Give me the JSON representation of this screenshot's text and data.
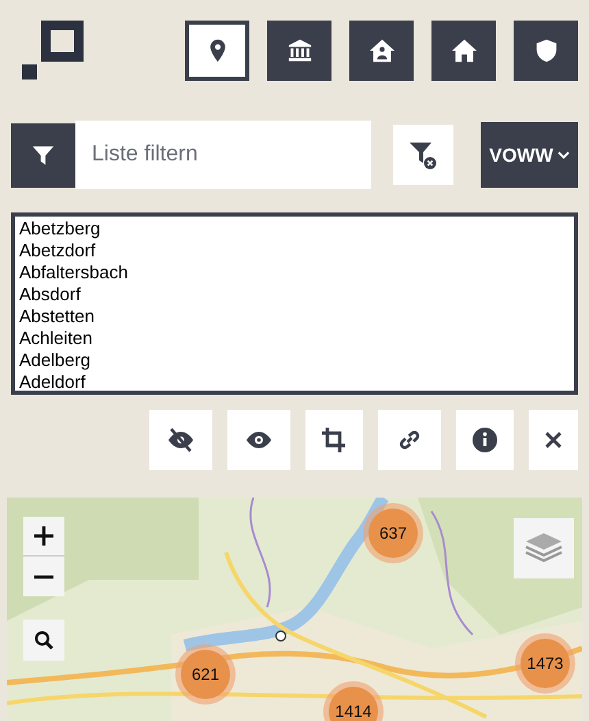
{
  "nav_buttons": [
    {
      "selected": true
    },
    {
      "selected": false
    },
    {
      "selected": false
    },
    {
      "selected": false
    },
    {
      "selected": false
    }
  ],
  "filter": {
    "placeholder": "Liste filtern"
  },
  "dropdown": {
    "label": "VOWW"
  },
  "list": [
    "Abetzberg",
    "Abetzdorf",
    "Abfaltersbach",
    "Absdorf",
    "Abstetten",
    "Achleiten",
    "Adelberg",
    "Adeldorf"
  ],
  "map": {
    "clusters": [
      {
        "label": "637"
      },
      {
        "label": "621"
      },
      {
        "label": "1473"
      },
      {
        "label": "1414"
      }
    ]
  }
}
